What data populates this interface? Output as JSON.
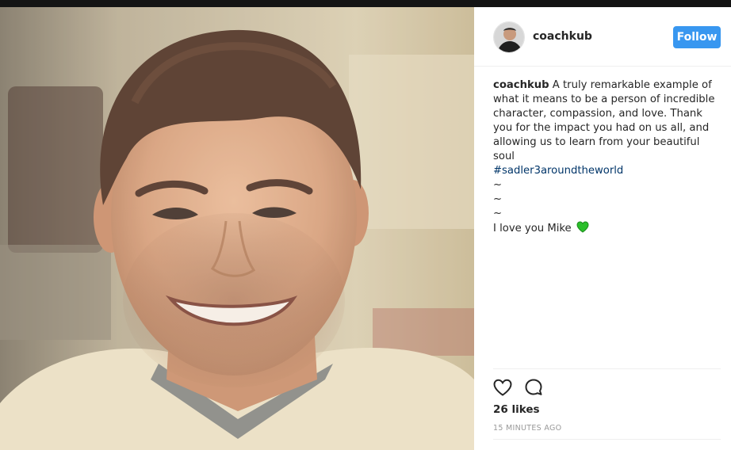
{
  "post": {
    "username": "coachkub",
    "follow_label": "Follow",
    "caption": {
      "author": "coachkub",
      "text": "A truly remarkable example of what it means to be a person of incredible character, compassion, and love. Thank you for the impact you had on us all, and allowing us to learn from your beautiful soul",
      "hashtag": "#sadler3aroundtheworld",
      "tilde_lines": [
        "~",
        "~",
        "~"
      ],
      "closing": "I love you Mike"
    },
    "likes": "26 likes",
    "timestamp": "15 MINUTES AGO"
  },
  "icons": {
    "like": "heart-outline-icon",
    "comment": "comment-bubble-icon",
    "emoji": "green-heart-emoji"
  },
  "colors": {
    "follow_button": "#3897f0",
    "hashtag": "#003569",
    "green_heart": "#2bbf2b",
    "timestamp": "#999999"
  }
}
